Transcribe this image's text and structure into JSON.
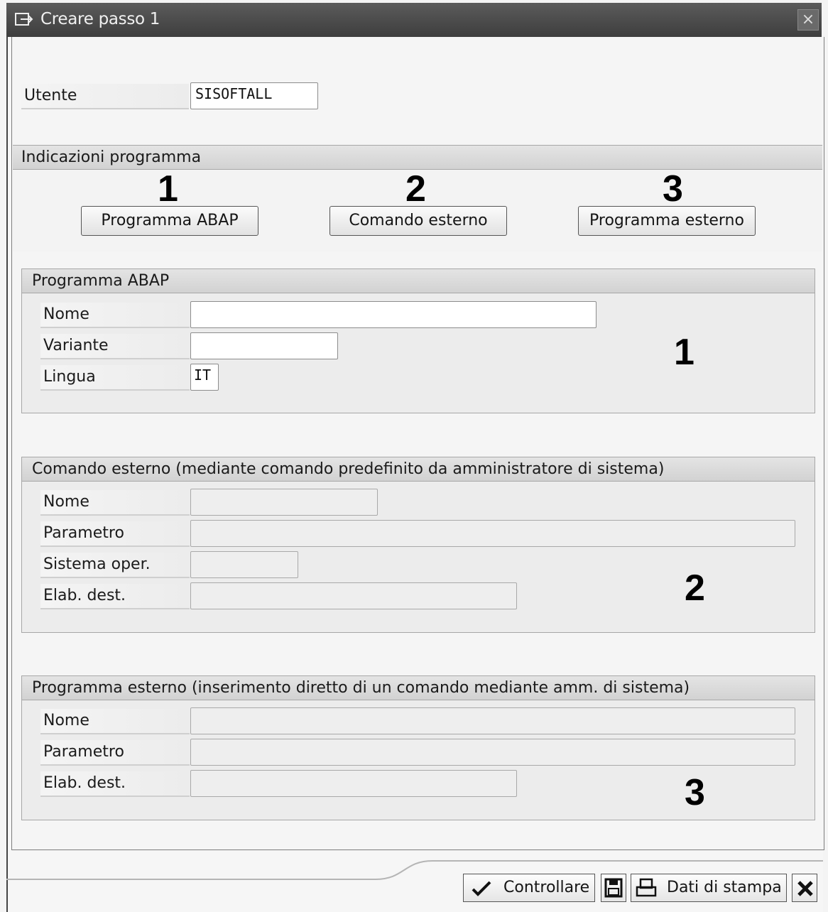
{
  "window": {
    "title": "Creare passo  1",
    "close_glyph": "×"
  },
  "user": {
    "label": "Utente",
    "value": "SISOFTALL"
  },
  "program_info": {
    "title": "Indicazioni programma",
    "markers": [
      "1",
      "2",
      "3"
    ],
    "buttons": [
      "Programma ABAP",
      "Comando esterno",
      "Programma esterno"
    ]
  },
  "abap_group": {
    "title": "Programma ABAP",
    "marker": "1",
    "fields": [
      {
        "label": "Nome",
        "value": ""
      },
      {
        "label": "Variante",
        "value": ""
      },
      {
        "label": "Lingua",
        "value": "IT"
      }
    ]
  },
  "ext_command_group": {
    "title": "Comando esterno (mediante comando predefinito da amministratore di sistema)",
    "marker": "2",
    "fields": [
      {
        "label": "Nome",
        "value": ""
      },
      {
        "label": "Parametro",
        "value": ""
      },
      {
        "label": "Sistema oper.",
        "value": ""
      },
      {
        "label": "Elab. dest.",
        "value": ""
      }
    ]
  },
  "ext_program_group": {
    "title": "Programma esterno (inserimento diretto di un comando mediante amm. di sistema)",
    "marker": "3",
    "fields": [
      {
        "label": "Nome",
        "value": ""
      },
      {
        "label": "Parametro",
        "value": ""
      },
      {
        "label": "Elab. dest.",
        "value": ""
      }
    ]
  },
  "toolbar": {
    "check_label": "Controllare",
    "print_label": "Dati di stampa",
    "icons": [
      "checkmark-icon",
      "save-icon",
      "print-icon",
      "close-icon"
    ]
  }
}
